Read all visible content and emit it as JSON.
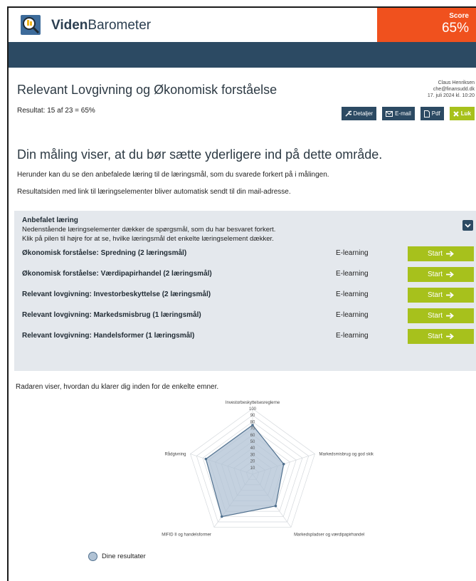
{
  "header": {
    "brand_bold": "Viden",
    "brand_light": "Barometer",
    "score_label": "Score",
    "score_value": "65%",
    "accent_color": "#f0511e",
    "nav_color": "#2c4a63"
  },
  "page": {
    "title": "Relevant Lovgivning og Økonomisk forståelse",
    "result": "Resultat: 15 af 23 = 65%",
    "user": {
      "name": "Claus Henriksen",
      "email": "che@finansudd.dk",
      "date": "17. juli 2024 kl. 10:20"
    },
    "actions": {
      "details": "Detaljer",
      "email": "E-mail",
      "pdf": "Pdf",
      "close": "Luk"
    }
  },
  "message": {
    "headline": "Din måling viser, at du bør sætte yderligere ind på dette område.",
    "line1": "Herunder kan du se den anbefalede læring til de læringsmål, som du svarede forkert på i målingen.",
    "line2": "Resultatsiden med link til læringselementer bliver automatisk sendt til din mail-adresse."
  },
  "recommended": {
    "title": "Anbefalet læring",
    "desc1": "Nedenstående læringselementer dækker de spørgsmål, som du har besvaret forkert.",
    "desc2": "Klik på pilen til højre for at se, hvilke læringsmål det enkelte læringselement dækker.",
    "items": [
      {
        "title": "Økonomisk forståelse: Spredning (2 læringsmål)",
        "type": "E-learning",
        "action": "Start"
      },
      {
        "title": "Økonomisk forståelse: Værdipapirhandel (2 læringsmål)",
        "type": "E-learning",
        "action": "Start"
      },
      {
        "title": "Relevant lovgivning: Investorbeskyttelse (2 læringsmål)",
        "type": "E-learning",
        "action": "Start"
      },
      {
        "title": "Relevant lovgivning: Markedsmisbrug (1 læringsmål)",
        "type": "E-learning",
        "action": "Start"
      },
      {
        "title": "Relevant lovgivning: Handelsformer (1 læringsmål)",
        "type": "E-learning",
        "action": "Start"
      }
    ]
  },
  "radar": {
    "caption": "Radaren viser, hvordan du klarer dig inden for de enkelte emner.",
    "legend": "Dine resultater",
    "fill_color": "#b0c2d4",
    "line_color": "#50708e"
  },
  "chart_data": {
    "type": "radar",
    "axes": [
      "Investorbeskyttelsesreglerne",
      "Markedsmisbrug og god skik",
      "Markedspladser og værdipapirhandel",
      "MIFID II og handelsformer",
      "Rådgivning"
    ],
    "ticks": [
      "10",
      "20",
      "30",
      "40",
      "50",
      "60",
      "70",
      "80",
      "90",
      "100"
    ],
    "ylim": [
      0,
      100
    ],
    "series": [
      {
        "name": "Dine resultater",
        "values": [
          75,
          50,
          60,
          80,
          75
        ]
      }
    ],
    "legend": "bottom-left"
  }
}
